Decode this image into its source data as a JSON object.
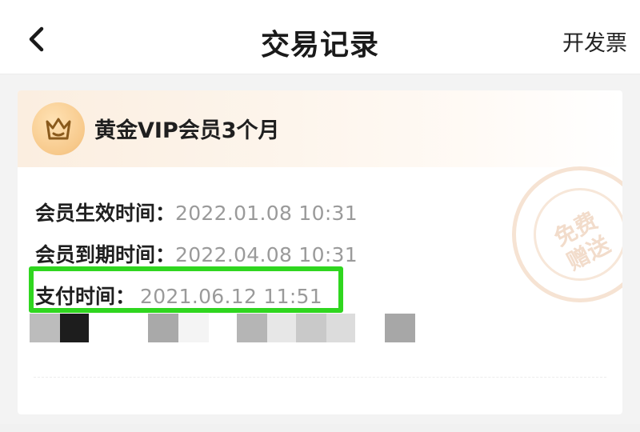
{
  "header": {
    "title": "交易记录",
    "back_icon": "chevron-left-icon",
    "invoice_label": "开发票"
  },
  "order": {
    "product_icon": "crown-icon",
    "product_name": "黄金VIP会员3个月",
    "stamp_text": "免费赠送",
    "rows": [
      {
        "label": "会员生效时间：",
        "value": "2022.01.08 10:31"
      },
      {
        "label": "会员到期时间：",
        "value": "2022.04.08 10:31"
      },
      {
        "label": "支付时间：",
        "value": "2021.06.12 11:51"
      }
    ],
    "highlight_color": "#2fd61f"
  }
}
